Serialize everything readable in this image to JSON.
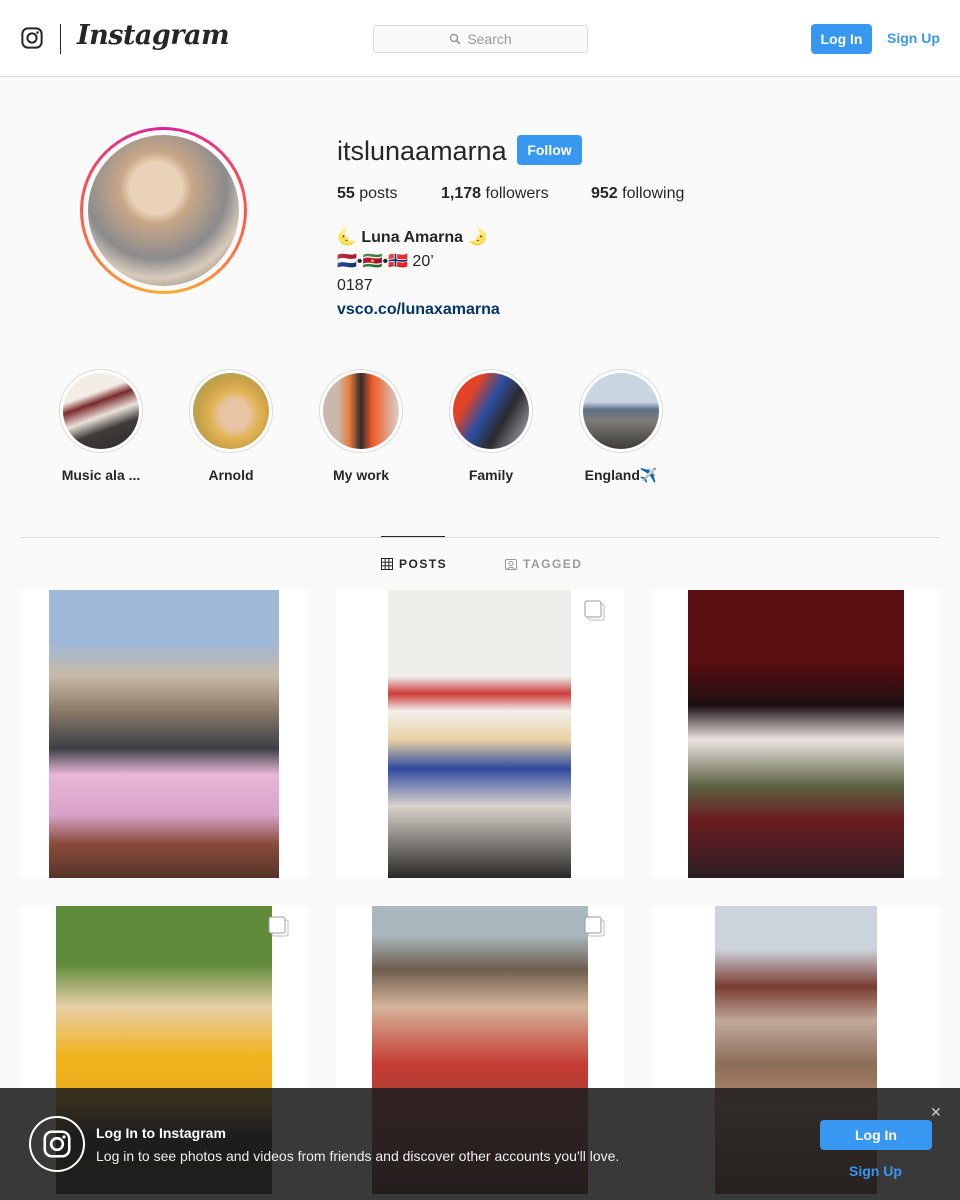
{
  "nav": {
    "brand": "Instagram",
    "search_placeholder": "Search",
    "login_label": "Log In",
    "signup_label": "Sign Up"
  },
  "profile": {
    "username": "itslunaamarna",
    "follow_label": "Follow",
    "posts_count": "55",
    "posts_label": " posts",
    "followers_count": "1,178",
    "followers_label": " followers",
    "following_count": "952",
    "following_label": " following",
    "bio_name": "🌜 Luna Amarna 🌛",
    "bio_line2": "🇳🇱•🇸🇷•🇳🇴 20’",
    "bio_line3": "0187",
    "bio_link": "vsco.co/lunaxamarna"
  },
  "highlights": [
    {
      "label": "Music ala ..."
    },
    {
      "label": "Arnold"
    },
    {
      "label": "My work"
    },
    {
      "label": "Family"
    },
    {
      "label": "England✈️"
    }
  ],
  "tabs": {
    "posts_label": "POSTS",
    "tagged_label": "TAGGED"
  },
  "posts": [
    {
      "name": "post-1",
      "multi": false
    },
    {
      "name": "post-2",
      "multi": true
    },
    {
      "name": "post-3",
      "multi": false
    },
    {
      "name": "post-4",
      "multi": true
    },
    {
      "name": "post-5",
      "multi": true
    },
    {
      "name": "post-6",
      "multi": false
    }
  ],
  "banner": {
    "title": "Log In to Instagram",
    "text": "Log in to see photos and videos from friends and discover other accounts you'll love.",
    "close_glyph": "✕",
    "login_label": "Log In",
    "signup_label": "Sign Up"
  },
  "colors": {
    "accent": "#3897f0",
    "link": "#003569"
  }
}
